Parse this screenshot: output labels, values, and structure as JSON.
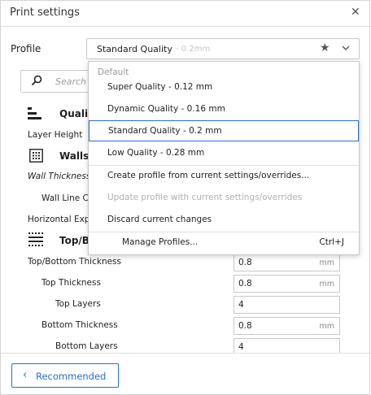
{
  "window": {
    "title": "Print settings",
    "close_glyph": "✕"
  },
  "profile": {
    "label": "Profile",
    "selected_value": "Standard Quality",
    "selected_sub": "- 0.2mm",
    "favorite_icon": "star-icon",
    "chevron_icon": "chevron-down-icon"
  },
  "search": {
    "placeholder": "Search"
  },
  "categories": [
    {
      "label": "Quali",
      "icon": "quality-icon"
    },
    {
      "label": "Walls",
      "icon": "walls-icon"
    },
    {
      "label": "Top/B",
      "icon": "top-bottom-icon"
    }
  ],
  "settings": {
    "layer_height": "Layer Height",
    "wall_thickness": "Wall Thickness",
    "wall_line_count": "Wall Line C",
    "horizontal_expansion": "Horizontal Exp",
    "top_bottom_thickness": {
      "label": "Top/Bottom Thickness",
      "value": "0.8",
      "unit": "mm"
    },
    "top_thickness": {
      "label": "Top Thickness",
      "value": "0.8",
      "unit": "mm"
    },
    "top_layers": {
      "label": "Top Layers",
      "value": "4"
    },
    "bottom_thickness": {
      "label": "Bottom Thickness",
      "value": "0.8",
      "unit": "mm"
    },
    "bottom_layers": {
      "label": "Bottom Layers",
      "value": "4"
    }
  },
  "dropdown": {
    "header": "Default",
    "items": [
      {
        "label": "Super Quality - 0.12 mm"
      },
      {
        "label": "Dynamic Quality - 0.16 mm"
      },
      {
        "label": "Standard Quality - 0.2 mm"
      },
      {
        "label": "Low Quality - 0.28 mm"
      }
    ],
    "create_profile": "Create profile from current settings/overrides...",
    "update_profile": "Update profile with current settings/overrides",
    "discard": "Discard current changes",
    "manage": "Manage Profiles...",
    "manage_shortcut": "Ctrl+J"
  },
  "footer": {
    "recommended_label": "Recommended",
    "back_glyph": "‹"
  },
  "colors": {
    "accent": "#2670c9",
    "border": "#c8c8c8",
    "muted": "#9a9a9a"
  }
}
